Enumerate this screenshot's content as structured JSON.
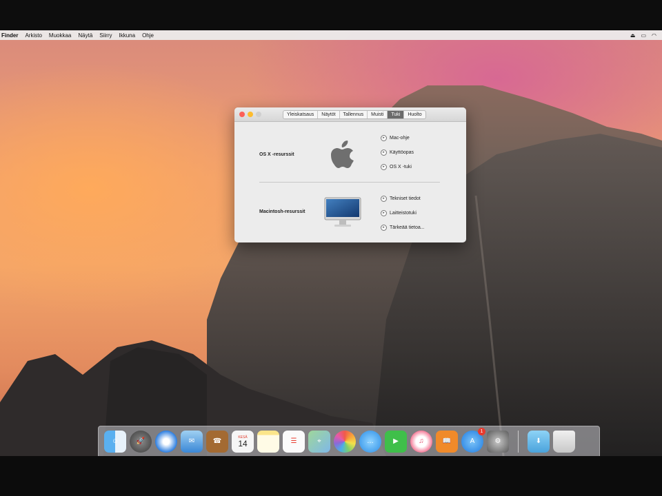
{
  "menubar": {
    "app": "Finder",
    "items": [
      "Arkisto",
      "Muokkaa",
      "Näytä",
      "Siirry",
      "Ikkuna",
      "Ohje"
    ]
  },
  "window": {
    "tabs": [
      "Yleiskatsaus",
      "Näytöt",
      "Tallennus",
      "Muisti",
      "Tuki",
      "Huolto"
    ],
    "active_tab": "Tuki",
    "sections": [
      {
        "label": "OS X -resurssit",
        "links": [
          "Mac-ohje",
          "Käyttöopas",
          "OS X -tuki"
        ]
      },
      {
        "label": "Macintosh-resurssit",
        "links": [
          "Tekniset tiedot",
          "Laitteistotuki",
          "Tärkeää tietoa..."
        ]
      }
    ]
  },
  "dock": {
    "apps": [
      "Finder",
      "Launchpad",
      "Safari",
      "Mail",
      "Yhteystiedot",
      "Kalenteri",
      "Muistiinpanot",
      "Muistutukset",
      "Kartat",
      "Kuvat",
      "Viestit",
      "FaceTime",
      "iTunes",
      "iBooks",
      "App Store",
      "Järjestelmäasetukset"
    ],
    "calendar_month": "KESÄ",
    "calendar_day": "14",
    "app_store_badge": "1",
    "stacks": [
      "Lataukset",
      "Roskakori"
    ]
  },
  "colors": {
    "active_tab": "#6b6b6b",
    "close": "#fc5f57",
    "minimize": "#fdbc2e",
    "zoom": "#cfcfcf"
  }
}
